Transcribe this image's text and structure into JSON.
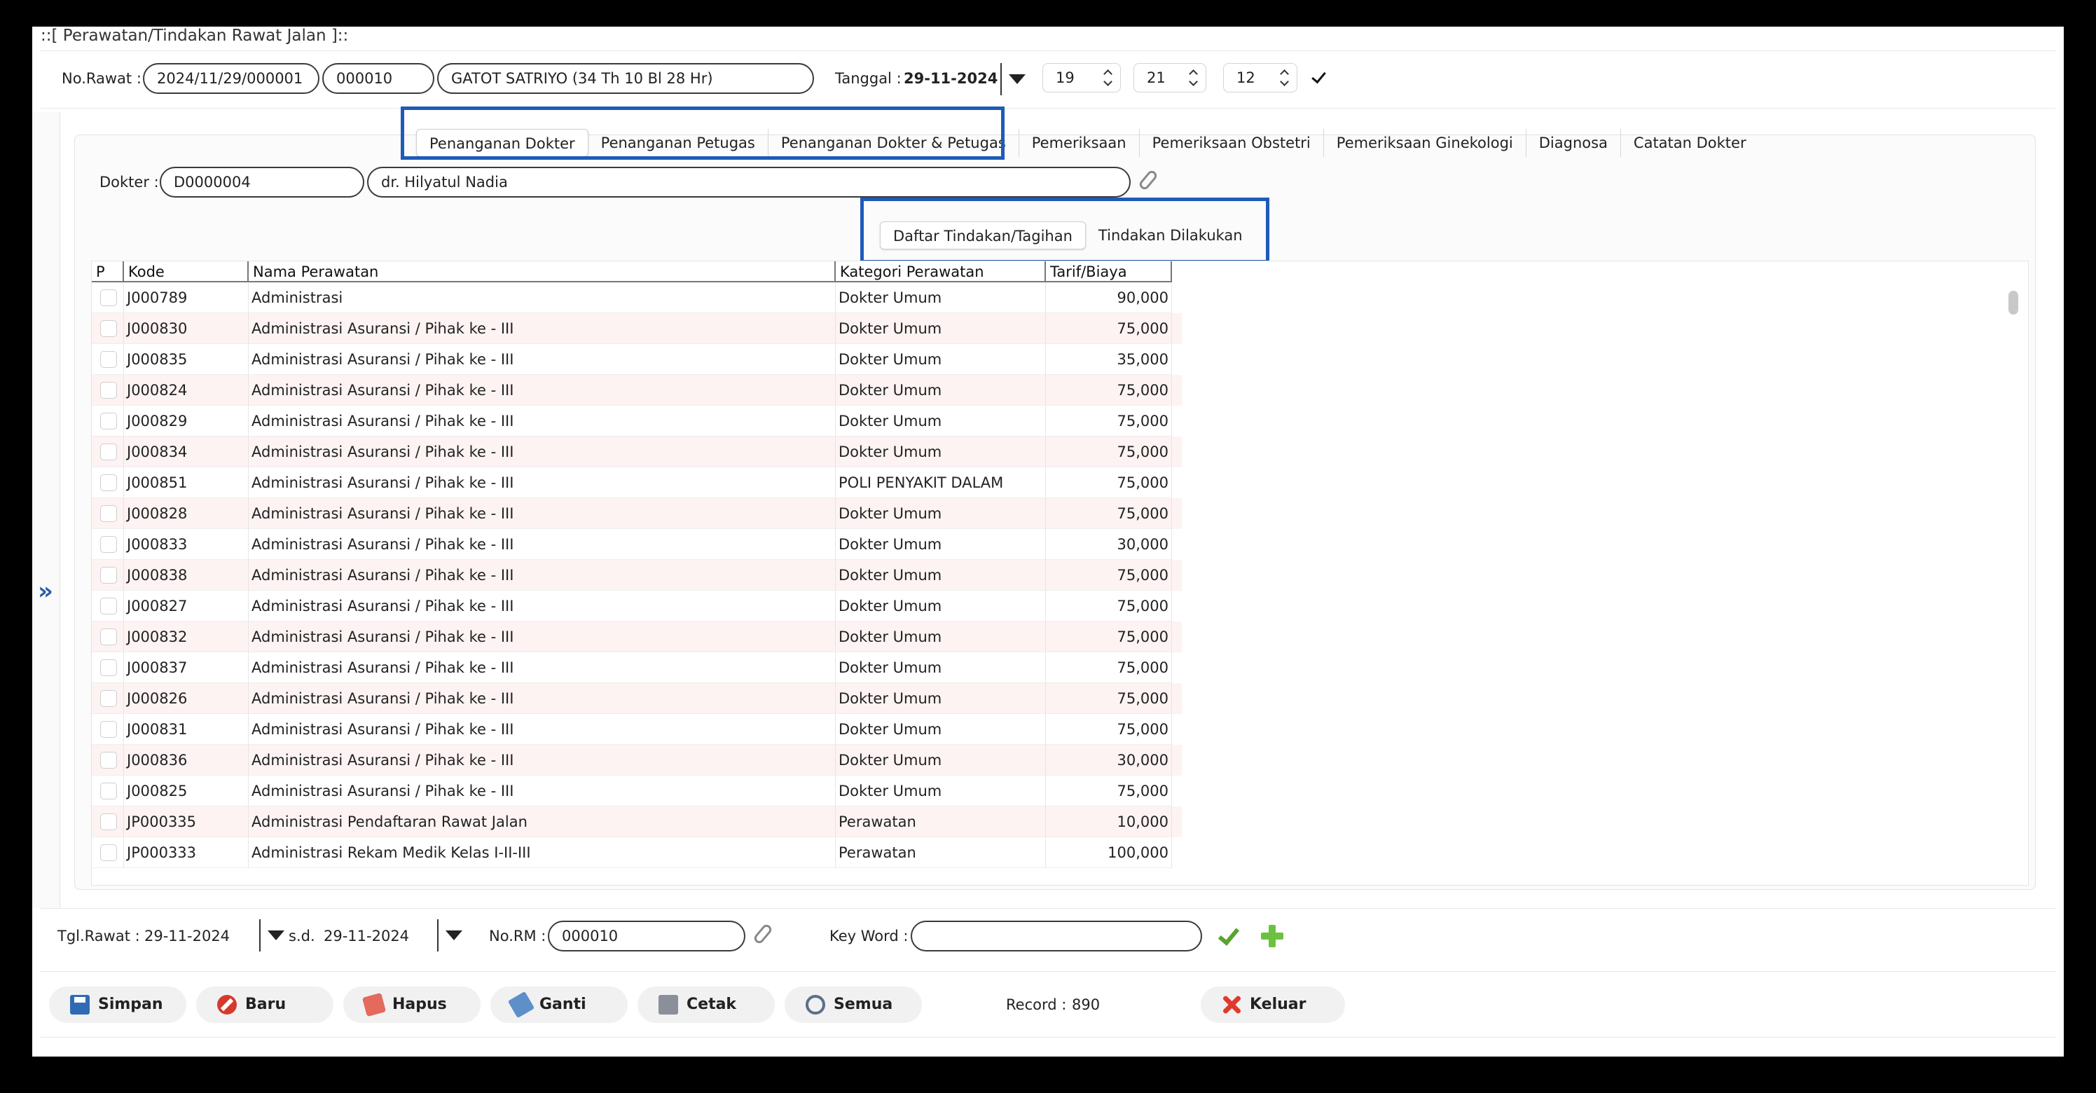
{
  "window": {
    "title": "::[ Perawatan/Tindakan Rawat Jalan ]::"
  },
  "header": {
    "no_rawat_label": "No.Rawat :",
    "no_rawat": "2024/11/29/000001",
    "no_rm": "000010",
    "patient": "GATOT SATRIYO (34 Th 10 Bl 28 Hr)",
    "tanggal_label": "Tanggal :",
    "tanggal": "29-11-2024",
    "hour": "19",
    "minute": "21",
    "second": "12"
  },
  "tabs": [
    {
      "label": "Penanganan Dokter"
    },
    {
      "label": "Penanganan Petugas"
    },
    {
      "label": "Penanganan Dokter & Petugas"
    },
    {
      "label": "Pemeriksaan"
    },
    {
      "label": "Pemeriksaan Obstetri"
    },
    {
      "label": "Pemeriksaan Ginekologi"
    },
    {
      "label": "Diagnosa"
    },
    {
      "label": "Catatan Dokter"
    }
  ],
  "dokter": {
    "label": "Dokter :",
    "code": "D0000004",
    "name": "dr. Hilyatul Nadia"
  },
  "subtabs": [
    {
      "label": "Daftar Tindakan/Tagihan"
    },
    {
      "label": "Tindakan Dilakukan"
    }
  ],
  "table": {
    "columns": [
      "P",
      "Kode",
      "Nama Perawatan",
      "Kategori Perawatan",
      "Tarif/Biaya"
    ],
    "rows": [
      {
        "kode": "J000789",
        "nama": "Administrasi",
        "kategori": "Dokter Umum",
        "tarif": "90,000"
      },
      {
        "kode": "J000830",
        "nama": "Administrasi  Asuransi / Pihak ke - III",
        "kategori": "Dokter Umum",
        "tarif": "75,000"
      },
      {
        "kode": "J000835",
        "nama": "Administrasi  Asuransi / Pihak ke - III",
        "kategori": "Dokter Umum",
        "tarif": "35,000"
      },
      {
        "kode": "J000824",
        "nama": "Administrasi  Asuransi / Pihak ke - III",
        "kategori": "Dokter Umum",
        "tarif": "75,000"
      },
      {
        "kode": "J000829",
        "nama": "Administrasi  Asuransi / Pihak ke - III",
        "kategori": "Dokter Umum",
        "tarif": "75,000"
      },
      {
        "kode": "J000834",
        "nama": "Administrasi  Asuransi / Pihak ke - III",
        "kategori": "Dokter Umum",
        "tarif": "75,000"
      },
      {
        "kode": "J000851",
        "nama": "Administrasi  Asuransi / Pihak ke - III",
        "kategori": "POLI PENYAKIT DALAM",
        "tarif": "75,000"
      },
      {
        "kode": "J000828",
        "nama": "Administrasi  Asuransi / Pihak ke - III",
        "kategori": "Dokter Umum",
        "tarif": "75,000"
      },
      {
        "kode": "J000833",
        "nama": "Administrasi  Asuransi / Pihak ke - III",
        "kategori": "Dokter Umum",
        "tarif": "30,000"
      },
      {
        "kode": "J000838",
        "nama": "Administrasi  Asuransi / Pihak ke - III",
        "kategori": "Dokter Umum",
        "tarif": "75,000"
      },
      {
        "kode": "J000827",
        "nama": "Administrasi  Asuransi / Pihak ke - III",
        "kategori": "Dokter Umum",
        "tarif": "75,000"
      },
      {
        "kode": "J000832",
        "nama": "Administrasi  Asuransi / Pihak ke - III",
        "kategori": "Dokter Umum",
        "tarif": "75,000"
      },
      {
        "kode": "J000837",
        "nama": "Administrasi  Asuransi / Pihak ke - III",
        "kategori": "Dokter Umum",
        "tarif": "75,000"
      },
      {
        "kode": "J000826",
        "nama": "Administrasi  Asuransi / Pihak ke - III",
        "kategori": "Dokter Umum",
        "tarif": "75,000"
      },
      {
        "kode": "J000831",
        "nama": "Administrasi  Asuransi / Pihak ke - III",
        "kategori": "Dokter Umum",
        "tarif": "75,000"
      },
      {
        "kode": "J000836",
        "nama": "Administrasi  Asuransi / Pihak ke - III",
        "kategori": "Dokter Umum",
        "tarif": "30,000"
      },
      {
        "kode": "J000825",
        "nama": "Administrasi  Asuransi / Pihak ke - III",
        "kategori": "Dokter Umum",
        "tarif": "75,000"
      },
      {
        "kode": "JP000335",
        "nama": "Administrasi Pendaftaran Rawat Jalan",
        "kategori": "Perawatan",
        "tarif": "10,000"
      },
      {
        "kode": "JP000333",
        "nama": "Administrasi Rekam Medik Kelas I-II-III",
        "kategori": "Perawatan",
        "tarif": "100,000"
      }
    ]
  },
  "filter": {
    "tgl_label": "Tgl.Rawat :",
    "tgl_from": "29-11-2024",
    "sd_label": "s.d.",
    "tgl_to": "29-11-2024",
    "norm_label": "No.RM :",
    "norm": "000010",
    "keyword_label": "Key Word :",
    "keyword": ""
  },
  "buttons": {
    "simpan": "Simpan",
    "baru": "Baru",
    "hapus": "Hapus",
    "ganti": "Ganti",
    "cetak": "Cetak",
    "semua": "Semua",
    "keluar": "Keluar"
  },
  "record": {
    "label": "Record :",
    "value": "890"
  },
  "colors": {
    "highlight": "#1e5bb8",
    "alt_row": "#fdf3f3"
  }
}
